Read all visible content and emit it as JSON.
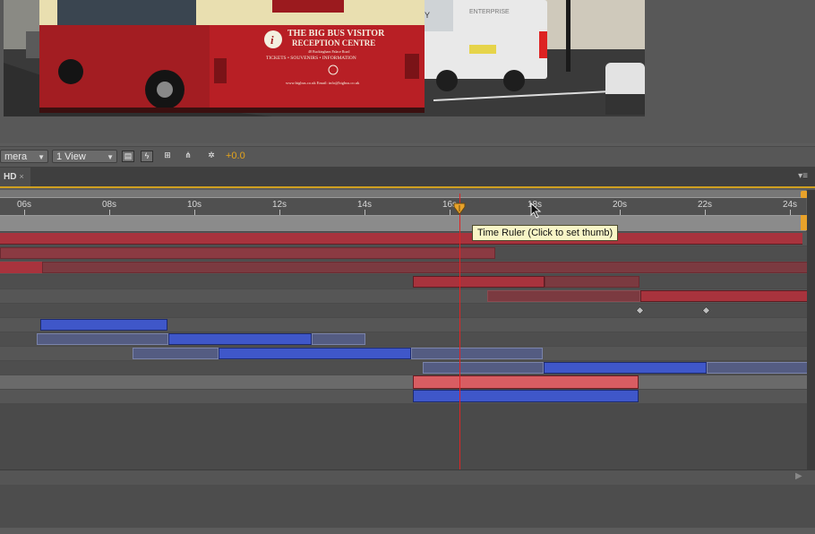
{
  "viewer": {
    "sign_line1": "THE BIG BUS VISITOR",
    "sign_line2": "RECEPTION CENTRE",
    "sign_address": "48 Buckingham Palace Road",
    "sign_items": "TICKETS  •  SOUVENIRS  •  INFORMATION",
    "sign_web": "www.bigbus.co.uk     Email: info@bigbus.co.uk",
    "van_brand": "ENTERPRISE",
    "van_text": "EY"
  },
  "toolbar": {
    "camera_label": "mera",
    "view_label": "1 View",
    "offset_value": "+0.0"
  },
  "panel": {
    "tab_label": "HD",
    "tab_close": "×",
    "menu_icon": "▾≡"
  },
  "ruler": {
    "tick_labels": [
      "06s",
      "08s",
      "10s",
      "12s",
      "14s",
      "16s",
      "18s",
      "20s",
      "22s",
      "24s"
    ]
  },
  "tooltip": "Time Ruler (Click to set thumb)",
  "colors": {
    "red_bar": "#a8333d",
    "red_bar_dim": "#7b3a40",
    "blue_bar": "#3f57c9",
    "blue_bar_dim": "#545c82",
    "playhead": "#e02424",
    "accent": "#e8a22a"
  }
}
